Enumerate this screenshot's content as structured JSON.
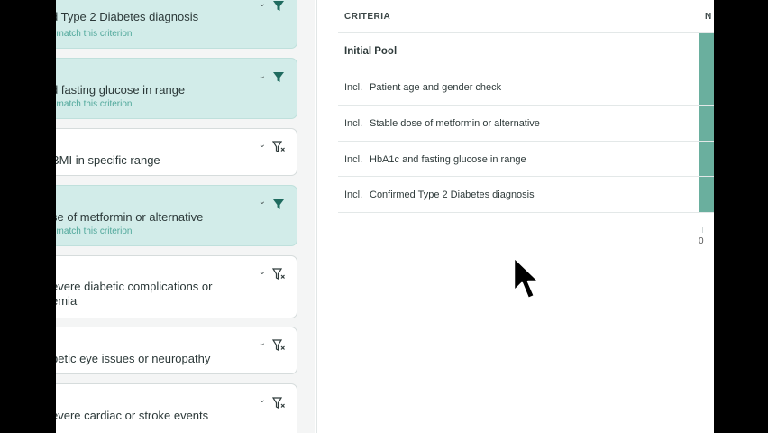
{
  "left_panel": {
    "cards": [
      {
        "title": "d Type 2 Diabetes diagnosis",
        "subtitle": "t match this criterion",
        "active": true,
        "filter_icon": "filter-filled-icon"
      },
      {
        "title": "d fasting glucose in range",
        "subtitle": "t match this criterion",
        "active": true,
        "filter_icon": "filter-filled-icon"
      },
      {
        "title": "BMI in specific range",
        "subtitle": "",
        "active": false,
        "filter_icon": "filter-x-icon"
      },
      {
        "title": "se of metformin or alternative",
        "subtitle": "t match this criterion",
        "active": true,
        "filter_icon": "filter-filled-icon"
      },
      {
        "title": "evere diabetic complications or",
        "title_line2": "emia",
        "subtitle": "",
        "active": false,
        "filter_icon": "filter-x-icon"
      },
      {
        "title": "betic eye issues or neuropathy",
        "subtitle": "",
        "active": false,
        "filter_icon": "filter-x-icon"
      },
      {
        "title": "evere cardiac or stroke events",
        "subtitle": "",
        "active": false,
        "filter_icon": "filter-x-icon"
      }
    ]
  },
  "table": {
    "header_criteria": "CRITERIA",
    "header_num": "N",
    "rows": [
      {
        "tag": "",
        "label": "Initial Pool"
      },
      {
        "tag": "Incl.",
        "label": "Patient age and gender check"
      },
      {
        "tag": "Incl.",
        "label": "Stable dose of metformin or alternative"
      },
      {
        "tag": "Incl.",
        "label": "HbA1c and fasting glucose in range"
      },
      {
        "tag": "Incl.",
        "label": "Confirmed Type 2 Diabetes diagnosis"
      }
    ],
    "axis_zero": "0"
  },
  "colors": {
    "active_card": "#d2ece9",
    "bar": "#6aaf9e",
    "subtitle_accent": "#4fa79a"
  }
}
